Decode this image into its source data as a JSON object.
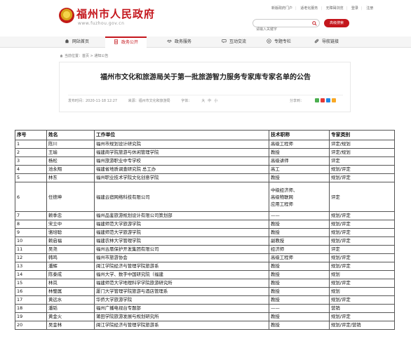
{
  "header": {
    "site_title": "福州市人民政府",
    "site_url": "www.fuzhou.gov.cn",
    "top_links": [
      "新版政府门户",
      "适老化服务",
      "无障碍浏览",
      "登录",
      "注册"
    ],
    "search_placeholder": "请输入关键字",
    "advanced_search": "高级搜索"
  },
  "nav": {
    "items": [
      "网站首页",
      "政务公开",
      "政务服务",
      "互动交流",
      "专题专栏",
      "导航链接"
    ],
    "active": "政务公开"
  },
  "breadcrumb": {
    "prefix": "当前位置：",
    "path": "首页 > 通知公告"
  },
  "article": {
    "title": "福州市文化和旅游局关于第一批旅游智力服务专家库专家名单的公告",
    "published": "发布时间：2020-11-18 12:27",
    "source": "来源：福州市文化和旅游局",
    "font_size_label": "字体：",
    "font_sizes": [
      "大",
      "中",
      "小"
    ],
    "share_label": "分享到："
  },
  "table": {
    "headers": [
      "序号",
      "姓名",
      "工作单位",
      "技术职称",
      "专家类别"
    ],
    "rows": [
      [
        "1",
        "陈川",
        "福州市规划设计研究院",
        "高级工程师",
        "评定/规划"
      ],
      [
        "2",
        "王瑜",
        "福建商学院旅游与休闲管理学院",
        "教授",
        "评定/规划"
      ],
      [
        "3",
        "杨松",
        "福州旅游职业中专学校",
        "高级讲师",
        "评定"
      ],
      [
        "4",
        "池永翔",
        "福建省地质调查研究院 总工办",
        "高工",
        "规划/评定"
      ],
      [
        "5",
        "林东",
        "福州职业技术学院文化创意学院",
        "教授",
        "规划/评定"
      ],
      [
        "6",
        "任德坤",
        "福建云宿网络科技有限公司",
        "中级经济师、\n高级物联网\n应用工程师",
        "评定"
      ],
      [
        "7",
        "赖季忠",
        "福州品鉴旅游规划设计有限公司策划部",
        "——",
        "规划/评定"
      ],
      [
        "8",
        "宋立中",
        "福建师范大学旅游学院",
        "教授",
        "规划/评定"
      ],
      [
        "9",
        "骆培聪",
        "福建师范大学旅游学院",
        "教授",
        "规划/评定"
      ],
      [
        "10",
        "赖启福",
        "福建农林大学管理学院",
        "副教授",
        "规划/评定"
      ],
      [
        "11",
        "吴尧",
        "福州古厝保护开发集团有限公司",
        "经济师",
        "评定"
      ],
      [
        "12",
        "韩鸣",
        "福州市旅游协会",
        "高级工程师",
        "规划/评定"
      ],
      [
        "13",
        "潘辉",
        "闽江学院经济与管理学院旅游系",
        "教授",
        "规划/评定"
      ],
      [
        "14",
        "陈泰成",
        "福州大学、数字中国研究院（福建",
        "教授",
        "规划"
      ],
      [
        "15",
        "林岚",
        "福建师范大学地理科学学院旅游研究所",
        "教授",
        "规划/评定"
      ],
      [
        "16",
        "林璧属",
        "厦门大学管理学院旅游与酒店管理系",
        "教授",
        "规划"
      ],
      [
        "17",
        "黄远水",
        "华侨大学旅游学院",
        "教授",
        "规划/评定"
      ],
      [
        "18",
        "潘韬",
        "福州广播电视台专题部",
        "——",
        "营销"
      ],
      [
        "19",
        "黄金火",
        "莆田学院旅游发展与规划研究所",
        "教授",
        "规划/评定"
      ],
      [
        "20",
        "吴金林",
        "闽江学院经济与管理学院旅游系",
        "教授",
        "规划/评定/营销"
      ]
    ]
  },
  "colors": {
    "brand_red": "#c4161c"
  }
}
